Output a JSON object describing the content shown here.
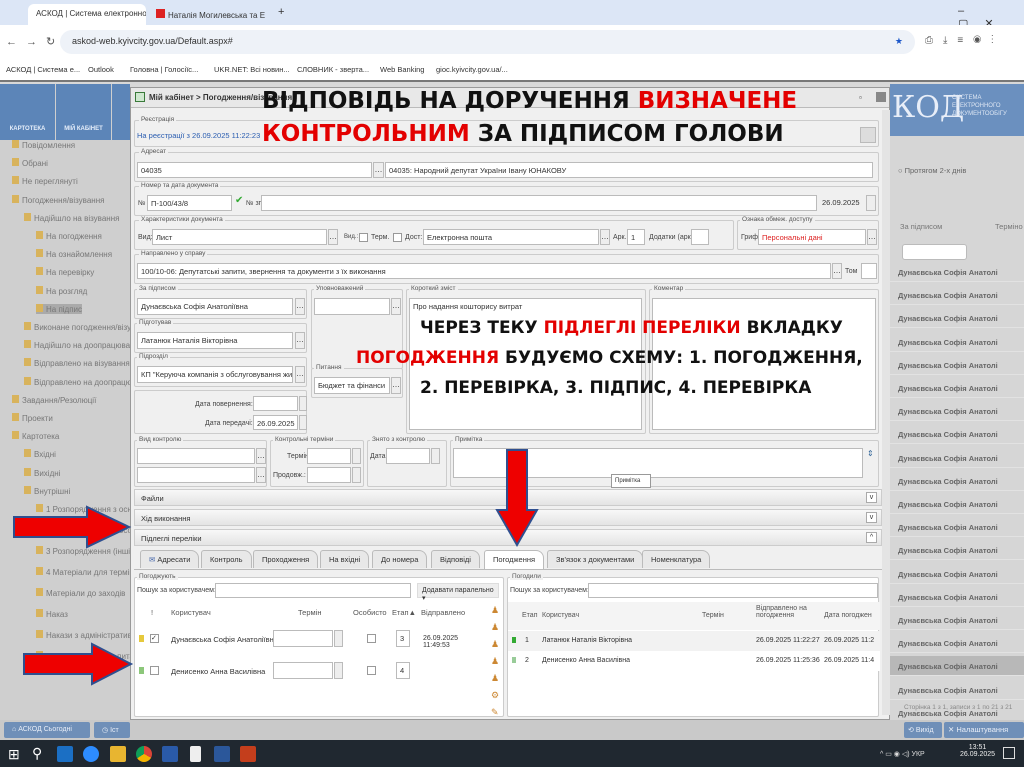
{
  "browser": {
    "tabs": [
      {
        "label": "АСКОД | Система електронно"
      },
      {
        "label": "Наталія Могилевська та Е"
      }
    ],
    "url": "askod-web.kyivcity.gov.ua/Default.aspx#",
    "bookmarks": [
      "АСКОД | Система е...",
      "Outlook",
      "Головна | Голосіїс...",
      "UKR.NET: Всі новин...",
      "СЛОВНИК - зверта...",
      "Web Banking",
      "gioc.kyivcity.gov.ua/..."
    ]
  },
  "toolbar": {
    "kartoteka": "КАРТОТЕКА",
    "my_cabinet": "МІЙ КАБІНЕТ"
  },
  "sidebar": {
    "items": [
      "Повідомлення",
      "Обрані",
      "Не переглянуті",
      "Погодження/візування",
      "Надійшло на візування",
      "На погодження",
      "На ознайомлення",
      "На перевірку",
      "На розгляд",
      "На підпис",
      "Виконане погодження/візува",
      "Надійшло на доопрацювання",
      "Відправлено на візування",
      "Відправлено на доопрацюван",
      "Завдання/Резолюції",
      "Проекти",
      "Картотека",
      "Вхідні",
      "Вихідні",
      "Внутрішні",
      "1 Розпорядження з основ",
      "2 Розпорядження з особо",
      "3 Розпорядження (інші)",
      "4 Матеріали для терміно",
      "Матеріали до заходів",
      "Наказ",
      "Накази з адміністративно",
      "Накази з кадрових питань"
    ]
  },
  "dialog": {
    "title": "Мій кабінет > Погодження/візування",
    "registration": {
      "legend": "Реєстрація",
      "status": "На реєстрації з 26.09.2025 11:22:23"
    },
    "addressee": {
      "legend": "Адресат",
      "code": "04035",
      "name": "04035: Народний депутат України Івану ЮНАКОВУ"
    },
    "number": {
      "legend": "Номер та дата документа",
      "no_label": "№",
      "no": "П-100/43/8",
      "zp_label": "№ зп",
      "date": "26.09.2025"
    },
    "chars": {
      "legend": "Характеристики документа",
      "vid_label": "Вид:",
      "vid": "Лист",
      "vid2_label": "Вид.:",
      "term_label": "Терм.",
      "dost_label": "Дост:",
      "dost": "Електронна пошта",
      "ark_label": "Арк.:",
      "ark": "1",
      "dod_label": "Додатки (арк.)",
      "access_legend": "Ознака обмеж. доступу",
      "grif_label": "Гриф:",
      "grif": "Персональні дані"
    },
    "case": {
      "legend": "Направлено у справу",
      "value": "100/10-06: Депутатські запити, звернення та документи з їх виконання",
      "tom_label": "Том"
    },
    "signer": {
      "legend": "За підписом",
      "value": "Дунаєвська Софія Анатоліївна"
    },
    "authorized": {
      "legend": "Уповноважений"
    },
    "summary": {
      "legend": "Короткий зміст",
      "value": "Про надання кошторису витрат"
    },
    "comment": {
      "legend": "Коментар"
    },
    "prepared": {
      "legend": "Підготував",
      "value": "Латанюк Наталія Вікторівна"
    },
    "dept": {
      "legend": "Підрозділ",
      "value": "КП \"Керуюча компанія з обслуговування житлс"
    },
    "question": {
      "legend": "Питання",
      "value": "Бюджет та фінанси"
    },
    "dates": {
      "return_label": "Дата повернення:",
      "transfer_label": "Дата передачі:",
      "transfer": "26.09.2025"
    },
    "control": {
      "legend": "Вид контролю",
      "terms_legend": "Контрольні терміни",
      "term_label": "Термін:",
      "extend_label": "Продовж.:",
      "removed_legend": "Знято з контролю",
      "date_label": "Дата:",
      "note_legend": "Примітка",
      "tooltip": "Примітка"
    },
    "sections": [
      "Файли",
      "Хід виконання",
      "Підлеглі переліки"
    ],
    "tabs": [
      "Адресати",
      "Контроль",
      "Проходження",
      "На вхідні",
      "До номера",
      "Відповіді",
      "Погодження",
      "Зв'язок з документами",
      "Номенклатура"
    ],
    "approvers": {
      "legend": "Погоджують",
      "search_label": "Пошук за користувачем:",
      "add_mode": "Додавати паралельно",
      "columns": [
        "!",
        "Користувач",
        "Термін",
        "Особисто",
        "Етап▲",
        "Відправлено"
      ],
      "rows": [
        {
          "user": "Дунаєвська Софія Анатоліївна",
          "stage": "3",
          "sent": "26.09.2025 11:49:53"
        },
        {
          "user": "Денисенко Анна Василівна",
          "stage": "4",
          "sent": ""
        }
      ]
    },
    "approved": {
      "legend": "Погодили",
      "search_label": "Пошук за користувачем:",
      "columns": [
        "Етап",
        "Користувач",
        "Термін",
        "Відправлено на погодження",
        "Дата погоджен"
      ],
      "rows": [
        {
          "stage": "1",
          "user": "Латанюк Наталія Вікторівна",
          "sent": "26.09.2025 11:22:27",
          "date": "26.09.2025 11:2"
        },
        {
          "stage": "2",
          "user": "Денисенко Анна Василівна",
          "sent": "26.09.2025 11:25:36",
          "date": "26.09.2025 11:4"
        }
      ]
    }
  },
  "overlay": {
    "headline_1a": "ВІДПОВІДЬ НА ДОРУЧЕННЯ ",
    "headline_1b": "ВИЗНАЧЕНЕ",
    "headline_2a": "КОНТРОЛЬНИМ",
    "headline_2b": " ЗА ПІДПИСОМ ГОЛОВИ",
    "note_1a": "ЧЕРЕЗ ТЕКУ ",
    "note_1b": "ПІДЛЕГЛІ ПЕРЕЛІКИ",
    "note_1c": " ВКЛАДКУ",
    "note_2a": "ПОГОДЖЕННЯ",
    "note_2b": " БУДУЄМО СХЕМУ: 1. ПОГОДЖЕННЯ,",
    "note_3": "2. ПЕРЕВІРКА, 3. ПІДПИС, 4. ПЕРЕВІРКА"
  },
  "right_panel": {
    "logo": "КОД",
    "logo_sub": "СИСТЕМА ЕЛЕКТРОННОГО ДОКУМЕНТООБІГУ",
    "radio": "Протягом 2-х днів",
    "col1": "За підписом",
    "col2": "Терміно",
    "row_value": "Дунаєвська Софія Анатолі",
    "pager": "Сторінка 1 з 1, записи з 1 по 21 з 21"
  },
  "appbar": {
    "today": "АСКОД Сьогодні",
    "history": "Іст",
    "exit": "Вихід",
    "settings": "Налаштування"
  },
  "taskbar": {
    "lang": "УКР",
    "time": "13:51",
    "date": "26.09.2025"
  }
}
